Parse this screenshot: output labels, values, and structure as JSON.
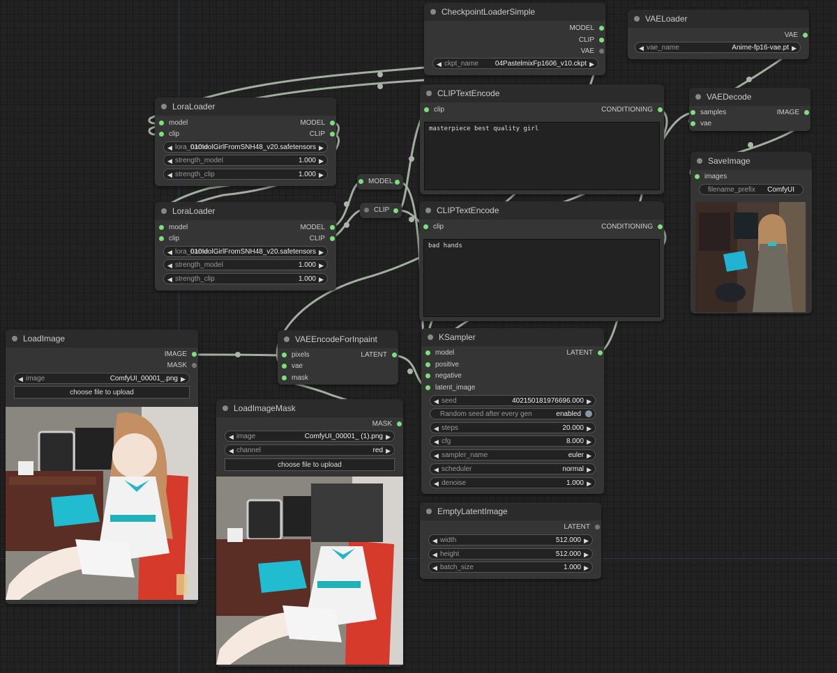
{
  "nodes": {
    "checkpoint": {
      "title": "CheckpointLoaderSimple",
      "outputs": [
        "MODEL",
        "CLIP",
        "VAE"
      ],
      "ckpt_label": "ckpt_name",
      "ckpt_value": "04PastelmixFp1606_v10.ckpt"
    },
    "vaeloader": {
      "title": "VAELoader",
      "output": "VAE",
      "vae_label": "vae_name",
      "vae_value": "Anime-fp16-vae.pt"
    },
    "lora1": {
      "title": "LoraLoader",
      "inputs": [
        "model",
        "clip"
      ],
      "outputs": [
        "MODEL",
        "CLIP"
      ],
      "lora_label": "lora_name",
      "lora_value": "010IdolGirlFromSNH48_v20.safetensors",
      "strength_model_label": "strength_model",
      "strength_model_value": "1.000",
      "strength_clip_label": "strength_clip",
      "strength_clip_value": "1.000"
    },
    "lora2": {
      "title": "LoraLoader",
      "inputs": [
        "model",
        "clip"
      ],
      "outputs": [
        "MODEL",
        "CLIP"
      ],
      "lora_label": "lora_name",
      "lora_value": "010IdolGirlFromSNH48_v20.safetensors",
      "strength_model_label": "strength_model",
      "strength_model_value": "1.000",
      "strength_clip_label": "strength_clip",
      "strength_clip_value": "1.000"
    },
    "reroute_model": {
      "label": "MODEL"
    },
    "reroute_clip": {
      "label": "CLIP"
    },
    "clip_pos": {
      "title": "CLIPTextEncode",
      "input": "clip",
      "output": "CONDITIONING",
      "text": "masterpiece best quality girl"
    },
    "clip_neg": {
      "title": "CLIPTextEncode",
      "input": "clip",
      "output": "CONDITIONING",
      "text": "bad hands"
    },
    "vaedecode": {
      "title": "VAEDecode",
      "inputs": [
        "samples",
        "vae"
      ],
      "output": "IMAGE"
    },
    "saveimage": {
      "title": "SaveImage",
      "input": "images",
      "prefix_label": "filename_prefix",
      "prefix_value": "ComfyUI"
    },
    "loadimage": {
      "title": "LoadImage",
      "outputs": [
        "IMAGE",
        "MASK"
      ],
      "image_label": "image",
      "image_value": "ComfyUI_00001_.png",
      "upload_label": "choose file to upload"
    },
    "vaeencode": {
      "title": "VAEEncodeForInpaint",
      "inputs": [
        "pixels",
        "vae",
        "mask"
      ],
      "output": "LATENT"
    },
    "ksampler": {
      "title": "KSampler",
      "inputs": [
        "model",
        "positive",
        "negative",
        "latent_image"
      ],
      "output": "LATENT",
      "widgets": [
        {
          "label": "seed",
          "value": "402150181976696.000"
        },
        {
          "label": "Random seed after every gen",
          "value": "enabled"
        },
        {
          "label": "steps",
          "value": "20.000"
        },
        {
          "label": "cfg",
          "value": "8.000"
        },
        {
          "label": "sampler_name",
          "value": "euler"
        },
        {
          "label": "scheduler",
          "value": "normal"
        },
        {
          "label": "denoise",
          "value": "1.000"
        }
      ]
    },
    "loadmask": {
      "title": "LoadImageMask",
      "output": "MASK",
      "image_label": "image",
      "image_value": "ComfyUI_00001_ (1).png",
      "channel_label": "channel",
      "channel_value": "red",
      "upload_label": "choose file to upload"
    },
    "emptylatent": {
      "title": "EmptyLatentImage",
      "output": "LATENT",
      "widgets": [
        {
          "label": "width",
          "value": "512.000"
        },
        {
          "label": "height",
          "value": "512.000"
        },
        {
          "label": "batch_size",
          "value": "1.000"
        }
      ]
    }
  },
  "colors": {
    "pin_active": "#7de07d",
    "link": "#aab7a8",
    "node_bg": "#353535",
    "canvas_bg": "#222222"
  }
}
